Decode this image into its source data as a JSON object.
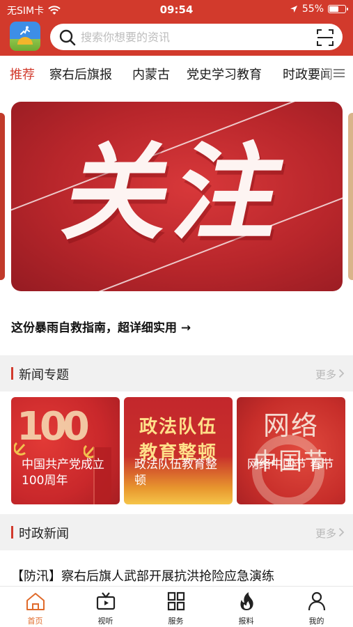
{
  "status_bar": {
    "carrier": "无SIM卡",
    "time": "09:54",
    "battery": "55%",
    "battery_level": 0.55
  },
  "search": {
    "placeholder": "搜索你想要的资讯"
  },
  "tabs": [
    {
      "label": "推荐",
      "active": true
    },
    {
      "label": "察右后旗报",
      "active": false
    },
    {
      "label": "内蒙古",
      "active": false
    },
    {
      "label": "党史学习教育",
      "active": false
    },
    {
      "label": "时政要闻",
      "active": false
    }
  ],
  "banner": {
    "image_text": "关注",
    "headline": "这份暴雨自救指南，超详细实用 →"
  },
  "topics_section": {
    "title": "新闻专题",
    "more": "更多",
    "cards": [
      {
        "label": "中国共产党成立100周年",
        "image_text": "100"
      },
      {
        "label": "政法队伍教育整顿",
        "image_text": "政法队伍 教育整顿"
      },
      {
        "label": "网络中国节 春节",
        "image_text": "网络 中国节"
      }
    ]
  },
  "news_section": {
    "title": "时政新闻",
    "more": "更多",
    "items": [
      {
        "title": "【防汛】察右后旗人武部开展抗洪抢险应急演练"
      }
    ]
  },
  "bottom_nav": [
    {
      "label": "首页",
      "icon": "home-icon",
      "active": true
    },
    {
      "label": "视听",
      "icon": "tv-icon",
      "active": false
    },
    {
      "label": "服务",
      "icon": "grid-icon",
      "active": false
    },
    {
      "label": "报料",
      "icon": "fire-icon",
      "active": false
    },
    {
      "label": "我的",
      "icon": "user-icon",
      "active": false
    }
  ],
  "colors": {
    "brand": "#d23a2c",
    "active_nav": "#e06a2a",
    "section_bg": "#f1f1f1"
  }
}
